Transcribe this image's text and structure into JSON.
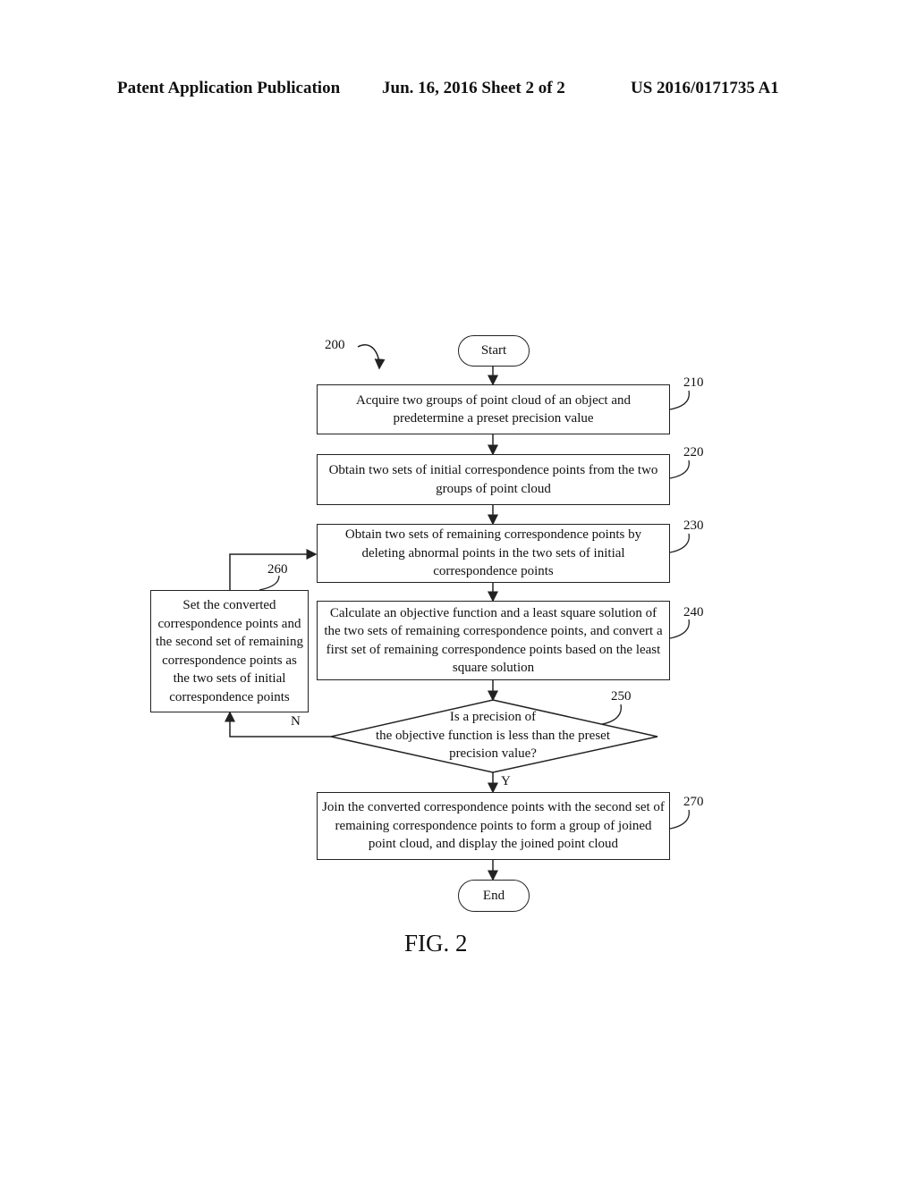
{
  "header": {
    "publication": "Patent Application Publication",
    "date_sheet": "Jun. 16, 2016  Sheet 2 of 2",
    "number": "US 2016/0171735 A1"
  },
  "diagram": {
    "ref": "200",
    "start": "Start",
    "end": "End",
    "steps": [
      {
        "ref": "210",
        "text": "Acquire two groups of point cloud of an object and predetermine a preset precision value"
      },
      {
        "ref": "220",
        "text": "Obtain two sets of initial correspondence points from the  two groups of point cloud"
      },
      {
        "ref": "230",
        "text": "Obtain two sets of remaining correspondence points by deleting abnormal points in the two sets of initial correspondence points"
      },
      {
        "ref": "240",
        "text": "Calculate an objective function and a least square solution of the two sets of remaining correspondence points, and convert a first set of remaining correspondence points based on the least square solution"
      },
      {
        "ref": "250",
        "text_lines": [
          "Is a precision of",
          "the objective function is less than the preset",
          "precision value?"
        ]
      },
      {
        "ref": "260",
        "text": "Set the converted correspondence points and the second set of remaining correspondence points as the two sets of initial correspondence points"
      },
      {
        "ref": "270",
        "text": "Join the converted correspondence points with the second set of remaining correspondence points to form a group of joined point cloud, and display the joined point cloud"
      }
    ],
    "branch_no": "N",
    "branch_yes": "Y",
    "figure_label": "FIG. 2"
  }
}
